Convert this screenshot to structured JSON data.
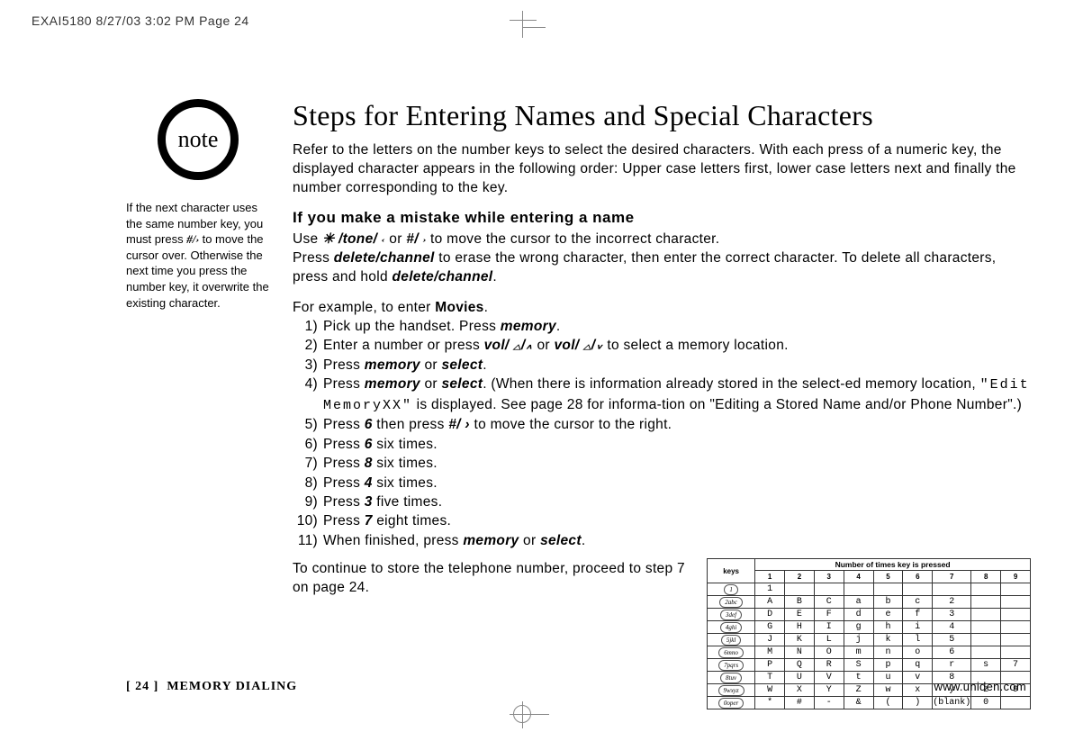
{
  "print_header": "EXAI5180  8/27/03 3:02 PM  Page 24",
  "note_label": "note",
  "sidebar_text_parts": {
    "p1": "If the next character uses the same number key, you must press ",
    "key": "#/",
    "arrow": "›",
    "p2": "  to move the cursor over. Otherwise the next time you press the number key, it overwrite the existing character."
  },
  "title": "Steps for Entering Names and Special Characters",
  "intro": "Refer to the letters on the number keys to select the desired characters. With each press of a numeric key, the displayed character appears in the following order: Upper case letters first, lower case letters next and finally the number corresponding to the key.",
  "mistake_heading": "If you make a mistake while entering a name",
  "mistake_line1_a": "Use ",
  "mistake_star_tone": "✳ /tone/",
  "mistake_line1_b": " or ",
  "mistake_pound": "#/",
  "mistake_line1_c": " to move the cursor to the incorrect character.",
  "mistake_line2_a": "Press ",
  "delete_channel": "delete/channel",
  "mistake_line2_b": " to erase the wrong character, then enter the correct character. To delete all characters, press and hold ",
  "mistake_line2_c": ".",
  "example_intro_a": "For example, to enter ",
  "example_intro_b": "Movies",
  "example_intro_c": ".",
  "steps": [
    {
      "n": "1)",
      "t": "Pick up the handset. Press <span class='bi'>memory</span>."
    },
    {
      "n": "2)",
      "t": "Enter a number or press <span class='bi'>vol/ <span class='tri'>△</span>/<span class='tri'>∧</span></span> or <span class='bi'>vol/ <span class='tri'>△</span>/<span class='tri'>∨</span></span> to select a memory location."
    },
    {
      "n": "3)",
      "t": "Press <span class='bi'>memory</span> or <span class='bi'>select</span>."
    },
    {
      "n": "4)",
      "t": "Press <span class='bi'>memory</span> or <span class='bi'>select</span>. (When there is information already stored in the select-ed memory location, <span class='dotmatrix'>\"Edit MemoryXX\"</span> is displayed. See page 28 for informa-tion on \"Editing a Stored Name and/or Phone Number\".)"
    },
    {
      "n": "5)",
      "t": "Press <span class='bi'>6</span> then press <span class='bi'>#/ ›</span> to move the cursor to the right."
    },
    {
      "n": "6)",
      "t": "Press <span class='bi'>6</span> six times."
    },
    {
      "n": "7)",
      "t": "Press <span class='bi'>8</span> six times."
    },
    {
      "n": "8)",
      "t": "Press <span class='bi'>4</span> six times."
    },
    {
      "n": "9)",
      "t": "Press <span class='bi'>3</span> five times."
    },
    {
      "n": "10)",
      "t": "Press <span class='bi'>7</span> eight times."
    },
    {
      "n": "11)",
      "t": "When finished, press <span class='bi'>memory</span> or <span class='bi'>select</span>."
    }
  ],
  "continue_text": "To continue to store the telephone number, proceed to step 7 on page 24.",
  "footer": {
    "page": "[ 24 ]",
    "section": "MEMORY DIALING",
    "url": "www.uniden.com"
  },
  "chart_data": {
    "type": "table",
    "title": "Number of times key is pressed",
    "first_col_header": "keys",
    "col_headers": [
      "1",
      "2",
      "3",
      "4",
      "5",
      "6",
      "7",
      "8",
      "9"
    ],
    "rows": [
      {
        "key": "1",
        "cells": [
          "1",
          "",
          "",
          "",
          "",
          "",
          "",
          "",
          ""
        ]
      },
      {
        "key": "2abc",
        "cells": [
          "A",
          "B",
          "C",
          "a",
          "b",
          "c",
          "2",
          "",
          ""
        ]
      },
      {
        "key": "3def",
        "cells": [
          "D",
          "E",
          "F",
          "d",
          "e",
          "f",
          "3",
          "",
          ""
        ]
      },
      {
        "key": "4ghi",
        "cells": [
          "G",
          "H",
          "I",
          "g",
          "h",
          "i",
          "4",
          "",
          ""
        ]
      },
      {
        "key": "5jkl",
        "cells": [
          "J",
          "K",
          "L",
          "j",
          "k",
          "l",
          "5",
          "",
          ""
        ]
      },
      {
        "key": "6mno",
        "cells": [
          "M",
          "N",
          "O",
          "m",
          "n",
          "o",
          "6",
          "",
          ""
        ]
      },
      {
        "key": "7pqrs",
        "cells": [
          "P",
          "Q",
          "R",
          "S",
          "p",
          "q",
          "r",
          "s",
          "7"
        ]
      },
      {
        "key": "8tuv",
        "cells": [
          "T",
          "U",
          "V",
          "t",
          "u",
          "v",
          "8",
          "",
          ""
        ]
      },
      {
        "key": "9wxyz",
        "cells": [
          "W",
          "X",
          "Y",
          "Z",
          "w",
          "x",
          "y",
          "z",
          "9"
        ]
      },
      {
        "key": "0oper",
        "cells": [
          "*",
          "#",
          "-",
          "&",
          "(",
          ")",
          "(blank)",
          "0",
          ""
        ]
      }
    ]
  }
}
